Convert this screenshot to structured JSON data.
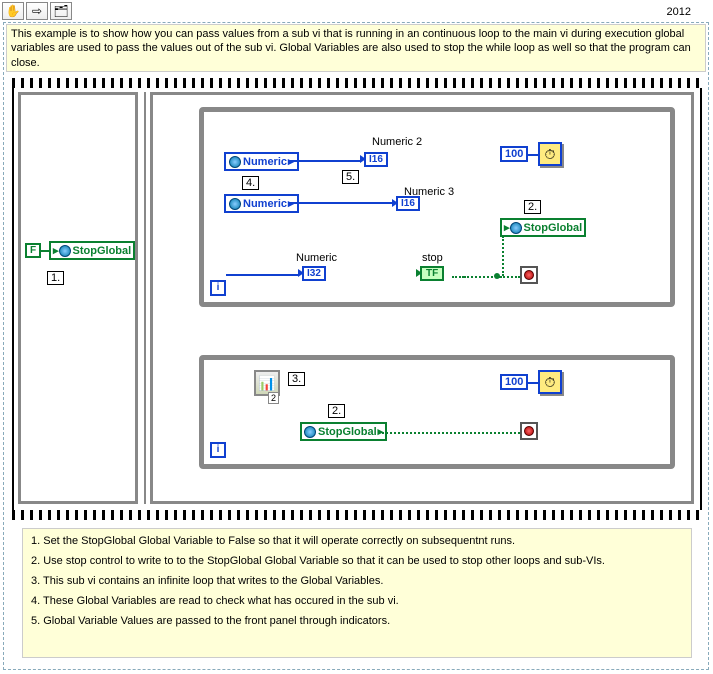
{
  "toolbar": {
    "icons": [
      "✋",
      "⇨",
      "📦"
    ]
  },
  "year": "2012",
  "description": "This example is to show how you can pass values from a sub vi  that is running in an continuous loop to the main vi during execution global variables are used to pass the values out of the sub vi.  Global Variables are also used to stop the while loop as well so that the program can close.",
  "seq1": {
    "const_false": "F",
    "stopglobal": "StopGlobal",
    "callout": "1."
  },
  "loop1": {
    "numeric1": "Numeric",
    "numeric2": "Numeric",
    "lbl_numeric": "Numeric",
    "lbl_numeric2": "Numeric 2",
    "lbl_numeric3": "Numeric 3",
    "lbl_stop": "stop",
    "i16": "I16",
    "i32": "I32",
    "tf": "TF",
    "stopglobal": "StopGlobal",
    "const100": "100",
    "callout2": "2.",
    "callout4": "4.",
    "callout5": "5."
  },
  "loop2": {
    "subvi_ix": "2",
    "stopglobal": "StopGlobal",
    "const100": "100",
    "callout2": "2.",
    "callout3": "3."
  },
  "notes": {
    "n1": "1.  Set the StopGlobal Global Variable to False so that it will operate correctly on subsequentnt runs.",
    "n2": "2. Use stop control to write to to the StopGlobal Global Variable so that it can be used to stop other loops and sub-VIs.",
    "n3": "3. This sub vi contains an infinite loop that writes to the Global Variables.",
    "n4": "4. These Global Variables are read to check what has occured in the sub vi.",
    "n5": "5.  Global Variable Values are passed to the front panel through indicators."
  }
}
